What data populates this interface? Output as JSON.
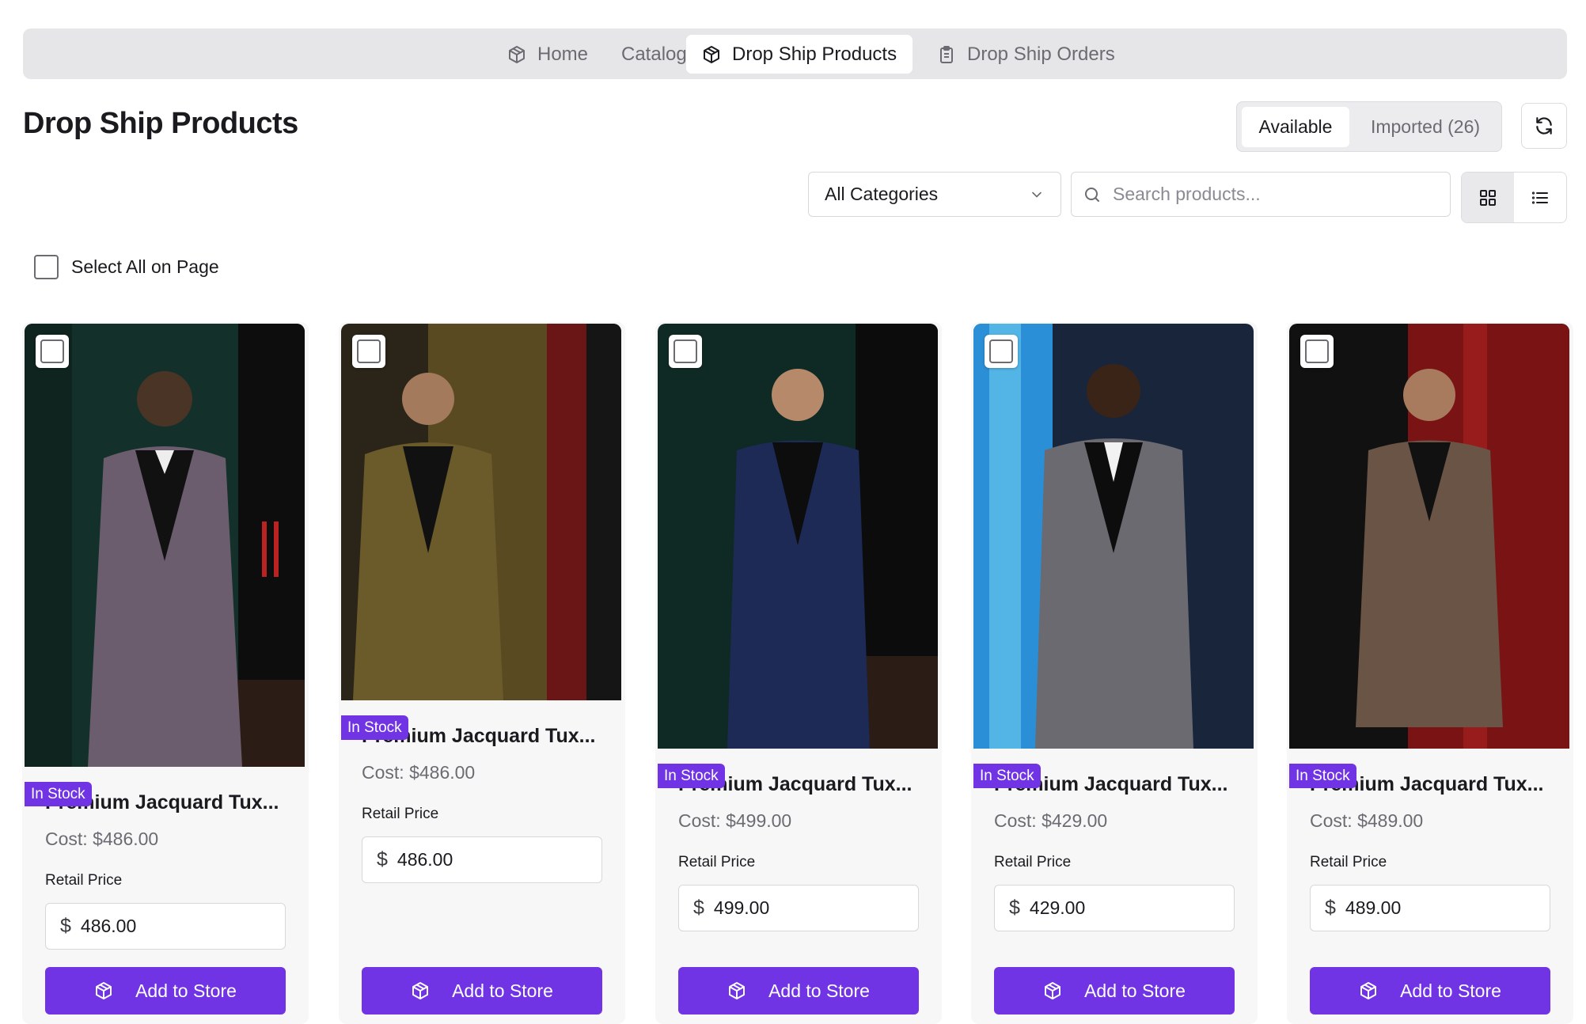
{
  "nav": {
    "items": [
      {
        "label": "Home",
        "icon": "box-icon"
      },
      {
        "label": "Catalog",
        "icon": ""
      },
      {
        "label": "Drop Ship Products",
        "icon": "box-icon"
      },
      {
        "label": "Drop Ship Orders",
        "icon": "clipboard-icon"
      }
    ]
  },
  "header": {
    "title": "Drop Ship Products",
    "tabs": [
      "Available",
      "Imported (26)"
    ]
  },
  "filters": {
    "category": "All Categories",
    "search_placeholder": "Search products..."
  },
  "select_all_label": "Select All on Page",
  "products": [
    {
      "badge": "In Stock",
      "name": "Premium Jacquard Tux...",
      "cost": "Cost: $486.00",
      "retail_label": "Retail Price",
      "currency": "$",
      "retail": "486.00",
      "button": "Add to Store"
    },
    {
      "badge": "In Stock",
      "name": "Premium Jacquard Tux...",
      "cost": "Cost: $486.00",
      "retail_label": "Retail Price",
      "currency": "$",
      "retail": "486.00",
      "button": "Add to Store"
    },
    {
      "badge": "In Stock",
      "name": "Premium Jacquard Tux...",
      "cost": "Cost: $499.00",
      "retail_label": "Retail Price",
      "currency": "$",
      "retail": "499.00",
      "button": "Add to Store"
    },
    {
      "badge": "In Stock",
      "name": "Premium Jacquard Tux...",
      "cost": "Cost: $429.00",
      "retail_label": "Retail Price",
      "currency": "$",
      "retail": "429.00",
      "button": "Add to Store"
    },
    {
      "badge": "In Stock",
      "name": "Premium Jacquard Tux...",
      "cost": "Cost: $489.00",
      "retail_label": "Retail Price",
      "currency": "$",
      "retail": "489.00",
      "button": "Add to Store"
    }
  ],
  "colors": {
    "accent": "#7034e4",
    "nav_bg": "#e6e6e8"
  }
}
